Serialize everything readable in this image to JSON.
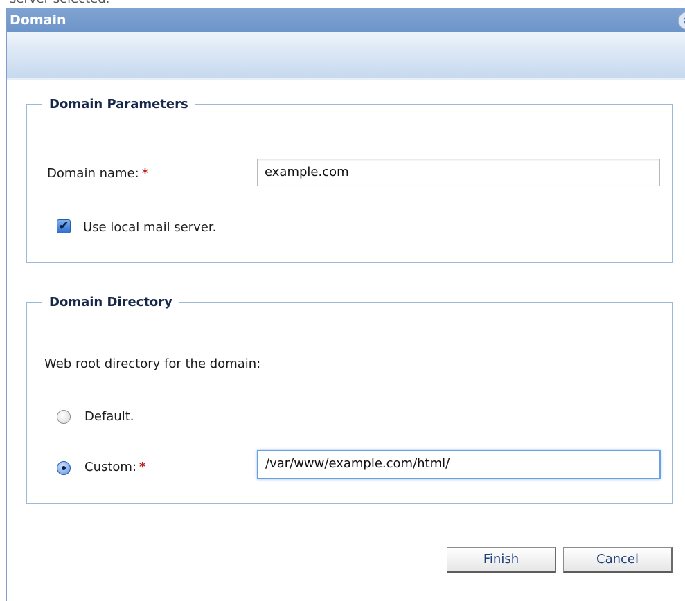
{
  "background_text": "server selected.",
  "dialog": {
    "title": "Domain",
    "close_glyph": "×"
  },
  "domain_parameters": {
    "legend": "Domain Parameters",
    "domain_name_label": "Domain name:",
    "required_marker": "*",
    "domain_name_value": "example.com",
    "use_local_mail_checked": true,
    "use_local_mail_label": "Use local mail server."
  },
  "domain_directory": {
    "legend": "Domain Directory",
    "web_root_label": "Web root directory for the domain:",
    "default_label": "Default.",
    "default_selected": false,
    "custom_label": "Custom:",
    "custom_selected": true,
    "custom_value": "/var/www/example.com/html/"
  },
  "buttons": {
    "finish": "Finish",
    "cancel": "Cancel"
  },
  "icons": {
    "close": "close-icon",
    "check": "checkmark-icon"
  },
  "colors": {
    "titlebar": "#7fa3d2",
    "fieldset_border": "#9cbad8",
    "required": "#c0201e",
    "focus_ring": "#6a9fe0"
  }
}
